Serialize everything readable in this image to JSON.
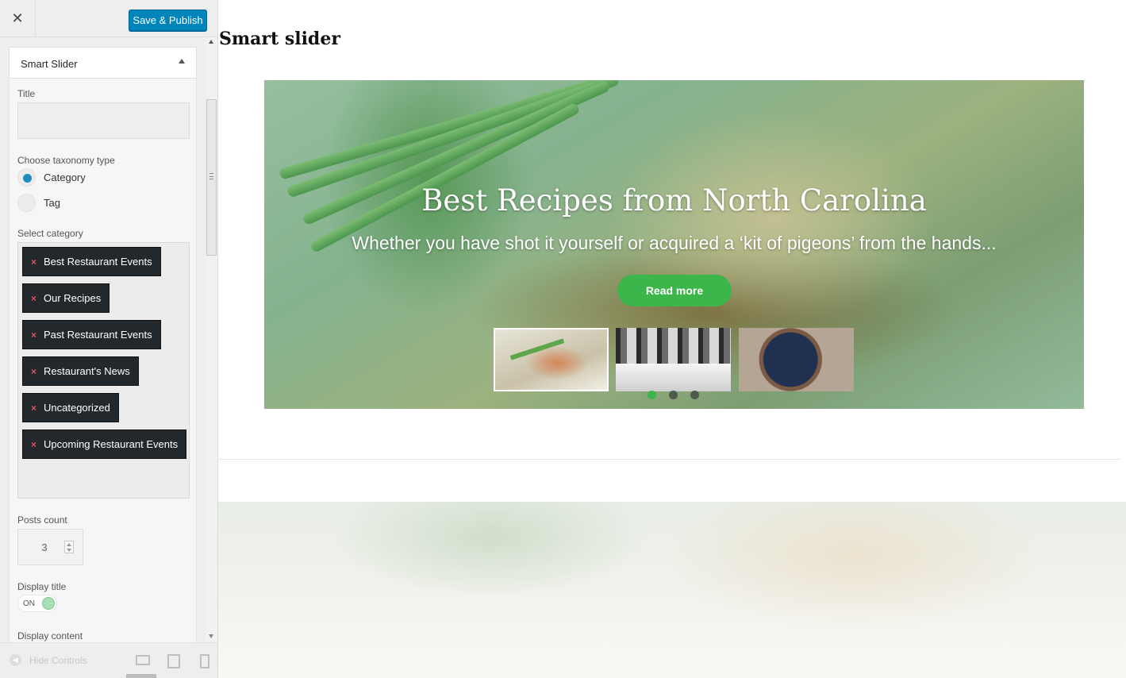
{
  "sidebar": {
    "close_glyph": "✕",
    "publish_label": "Save & Publish",
    "widget": {
      "title": "Smart Slider",
      "title_label": "Title",
      "title_value": "",
      "taxonomy_label": "Choose taxonomy type",
      "taxonomy_options": [
        {
          "label": "Category",
          "selected": true
        },
        {
          "label": "Tag",
          "selected": false
        }
      ],
      "category_label": "Select category",
      "categories": [
        "Best Restaurant Events",
        "Our Recipes",
        "Past Restaurant Events",
        "Restaurant's News",
        "Uncategorized",
        "Upcoming Restaurant Events"
      ],
      "remove_glyph": "×",
      "posts_count_label": "Posts count",
      "posts_count": "3",
      "display_title_label": "Display title",
      "display_title_state": "ON",
      "display_content_label": "Display content"
    },
    "footer": {
      "hide_controls_label": "Hide Controls",
      "hide_icon_glyph": "◀",
      "devices": [
        "desktop-icon",
        "tablet-icon",
        "mobile-icon"
      ]
    }
  },
  "preview": {
    "page_title": "Smart slider",
    "slide": {
      "title": "Best Recipes from North Carolina",
      "excerpt": "Whether you have shot it yourself or acquired a ‘kit of pigeons’ from the hands...",
      "button_label": "Read more"
    },
    "slides_count": 3,
    "active_slide": 1
  },
  "colors": {
    "publish_blue": "#0085ba",
    "chip_dark": "#23282d",
    "remove_red": "#e0555a",
    "accent_green": "#3cb54a",
    "radio_blue": "#1e8cbe"
  }
}
